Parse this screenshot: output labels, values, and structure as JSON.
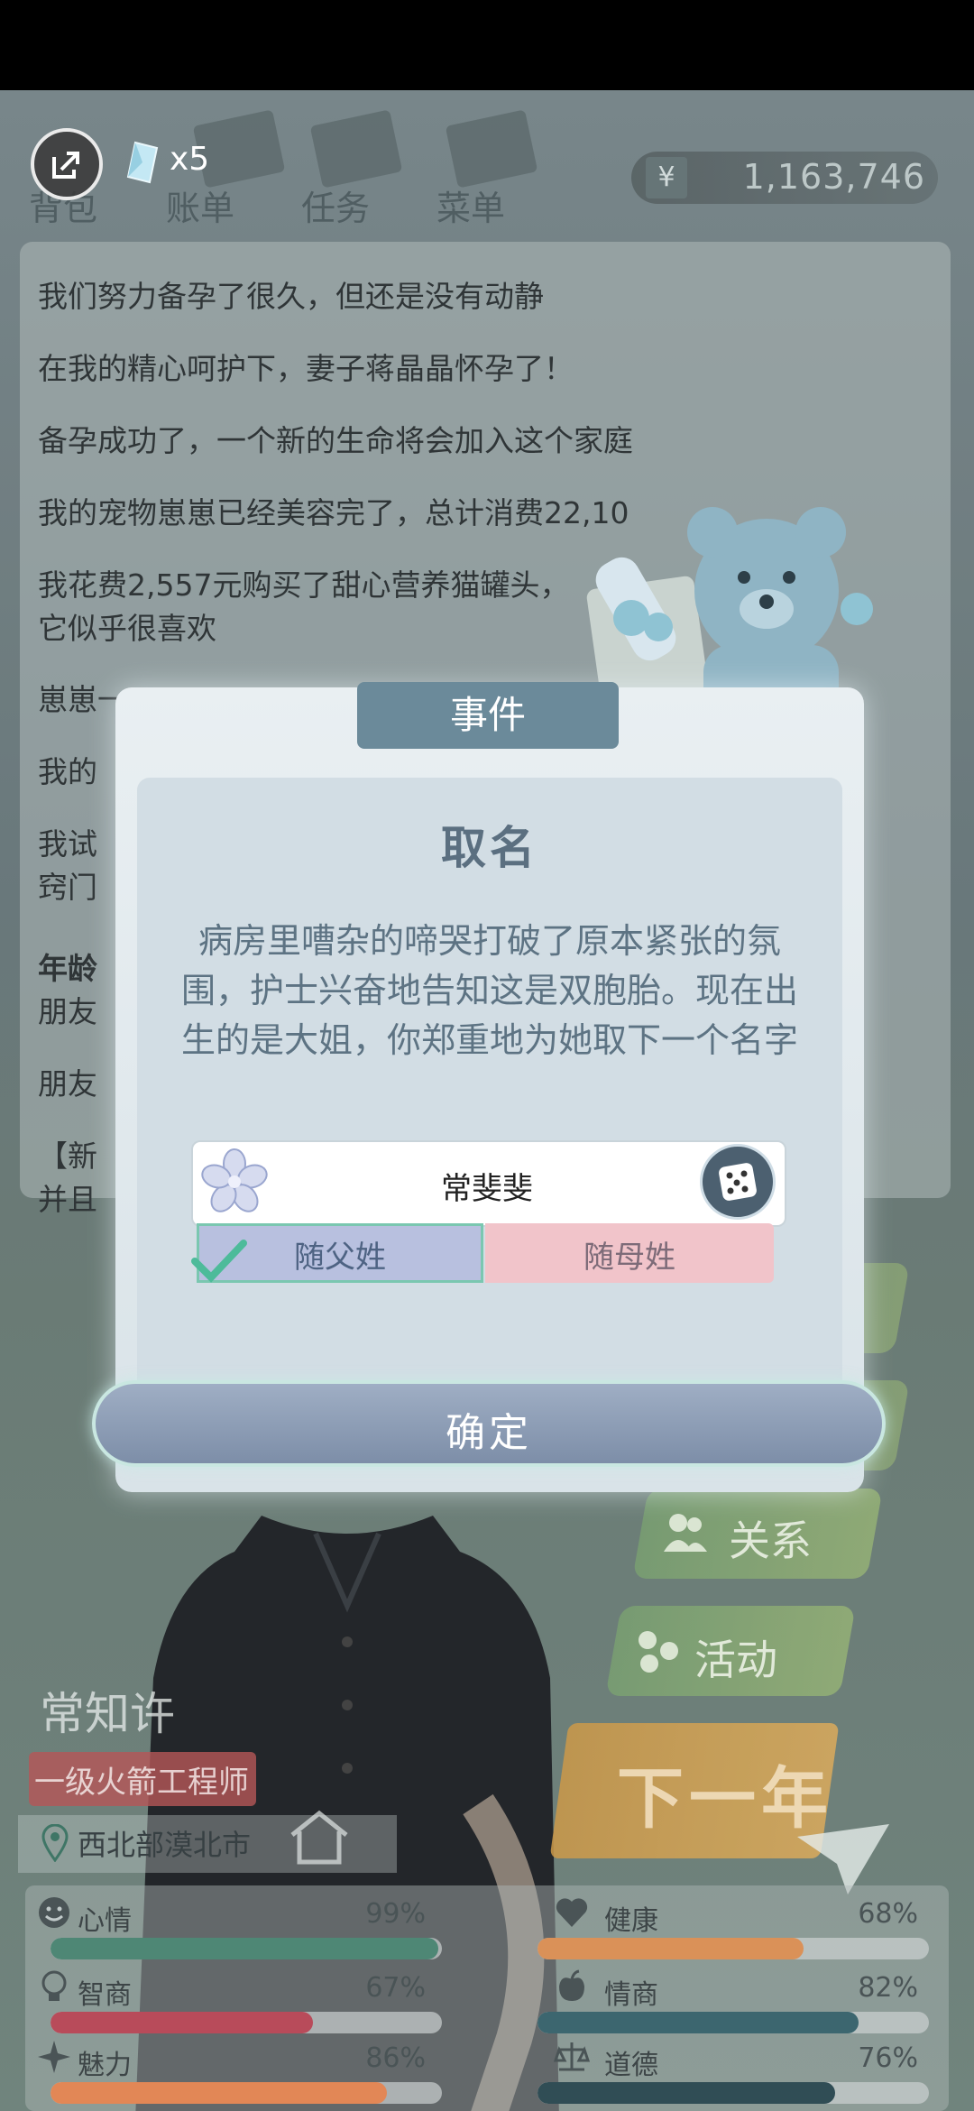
{
  "topbar": {
    "tabs": [
      "背包",
      "账单",
      "任务",
      "菜单"
    ],
    "gem_count": "x5",
    "money_symbol": "¥",
    "money": "1,163,746"
  },
  "log": [
    "我们努力备孕了很久，但还是没有动静",
    "在我的精心呵护下，妻子蒋晶晶怀孕了！",
    "备孕成功了，一个新的生命将会加入这个家庭",
    "我的宠物崽崽已经美容完了，总计消费22,10",
    "我花费2,557元购买了甜心营养猫罐头，",
    "它似乎很喜欢",
    "崽崽一",
    "我的",
    "我试",
    "窍门",
    "年龄",
    "朋友",
    "朋友",
    "【新",
    "并且"
  ],
  "side_buttons": {
    "relations": "关系",
    "activity": "活动",
    "next_year": "下一年"
  },
  "character": {
    "name": "常知许",
    "job": "一级火箭工程师",
    "location": "西北部漠北市"
  },
  "stats": [
    {
      "label": "心情",
      "value": "99%",
      "fill": 0.99,
      "color": "#3f7d6a",
      "icon": "smile-icon"
    },
    {
      "label": "健康",
      "value": "68%",
      "fill": 0.68,
      "color": "#d7884a",
      "icon": "heart-icon"
    },
    {
      "label": "智商",
      "value": "67%",
      "fill": 0.67,
      "color": "#b23c4c",
      "icon": "bulb-icon"
    },
    {
      "label": "情商",
      "value": "82%",
      "fill": 0.82,
      "color": "#2c5a63",
      "icon": "apple-icon"
    },
    {
      "label": "魅力",
      "value": "86%",
      "fill": 0.86,
      "color": "#e07d48",
      "icon": "sparkle-icon"
    },
    {
      "label": "道德",
      "value": "76%",
      "fill": 0.76,
      "color": "#1f3e47",
      "icon": "scale-icon"
    }
  ],
  "modal": {
    "tab": "事件",
    "title": "取名",
    "body": "病房里嘈杂的啼哭打破了原本紧张的氛围，护士兴奋地告知这是双胞胎。现在出生的是大姐，你郑重地为她取下一个名字",
    "name_value": "常斐斐",
    "surname_father": "随父姓",
    "surname_mother": "随母姓",
    "confirm": "确定"
  },
  "colors": {
    "modal_accent": "#6b8a9a",
    "confirm": "#8a9ab4",
    "father_selected": "#b8c0df",
    "mother": "#f1c4ca"
  }
}
